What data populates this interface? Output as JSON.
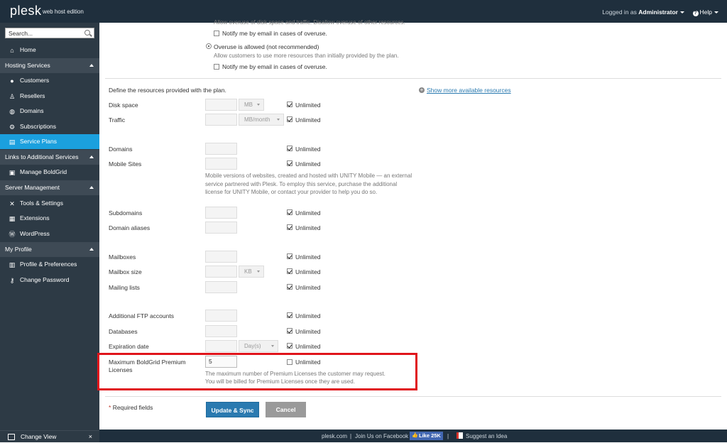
{
  "topbar": {
    "logo": "plesk",
    "edition": "web host edition",
    "logged_prefix": "Logged in as",
    "user": "Administrator",
    "help": "Help"
  },
  "sidebar": {
    "search_placeholder": "Search...",
    "home": "Home",
    "sections": [
      {
        "title": "Hosting Services",
        "items": [
          "Customers",
          "Resellers",
          "Domains",
          "Subscriptions",
          "Service Plans"
        ]
      },
      {
        "title": "Links to Additional Services",
        "items": [
          "Manage BoldGrid"
        ]
      },
      {
        "title": "Server Management",
        "items": [
          "Tools & Settings",
          "Extensions",
          "WordPress"
        ]
      },
      {
        "title": "My Profile",
        "items": [
          "Profile & Preferences",
          "Change Password"
        ]
      }
    ],
    "change_view": "Change View",
    "close_glyph": "×"
  },
  "overuse": {
    "cut_text": "Allow overuse of disk space and traffic. Disallow overuse of other resources.",
    "notify1": "Notify me by email in cases of overuse.",
    "allowed_label": "Overuse is allowed (not recommended)",
    "allowed_desc": "Allow customers to use more resources than initially provided by the plan.",
    "notify2": "Notify me by email in cases of overuse."
  },
  "resources": {
    "intro": "Define the resources provided with the plan.",
    "show_more": "Show more available resources",
    "unlimited": "Unlimited",
    "rows": {
      "disk_space": {
        "label": "Disk space",
        "unit": "MB"
      },
      "traffic": {
        "label": "Traffic",
        "unit": "MB/month"
      },
      "domains": {
        "label": "Domains"
      },
      "mobile_sites": {
        "label": "Mobile Sites",
        "note": "Mobile versions of websites, created and hosted with UNITY Mobile — an external service partnered with Plesk. To employ this service, purchase the additional license for UNITY Mobile, or contact your provider to help you do so."
      },
      "subdomains": {
        "label": "Subdomains"
      },
      "domain_aliases": {
        "label": "Domain aliases"
      },
      "mailboxes": {
        "label": "Mailboxes"
      },
      "mailbox_size": {
        "label": "Mailbox size",
        "unit": "KB"
      },
      "mailing_lists": {
        "label": "Mailing lists"
      },
      "ftp_accounts": {
        "label": "Additional FTP accounts"
      },
      "databases": {
        "label": "Databases"
      },
      "expiration": {
        "label": "Expiration date",
        "unit": "Day(s)"
      },
      "boldgrid": {
        "label_line1": "Maximum BoldGrid Premium",
        "label_line2": "Licenses",
        "value": "5",
        "note_line1": "The maximum number of Premium Licenses the customer may request.",
        "note_line2": "You will be billed for Premium Licenses once they are used."
      }
    }
  },
  "form": {
    "required": "Required fields",
    "required_star": "*",
    "update_btn": "Update & Sync",
    "cancel_btn": "Cancel"
  },
  "footer": {
    "site": "plesk.com",
    "divider": "|",
    "facebook": "Join Us on Facebook",
    "like": "Like 25K",
    "idea": "Suggest an Idea"
  }
}
